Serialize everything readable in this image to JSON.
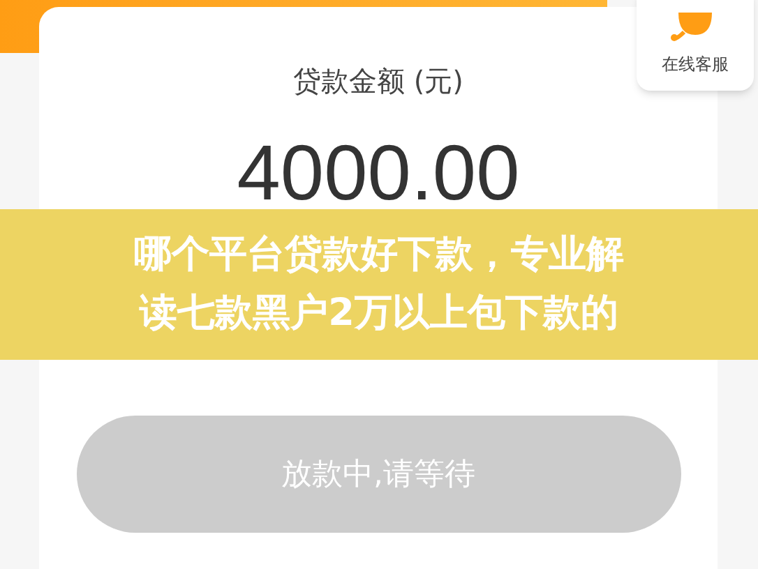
{
  "service": {
    "label": "在线客服"
  },
  "amount_label": "贷款金额 (元)",
  "amount": "4000.00",
  "button": {
    "label": "放款中,请等待",
    "disabled": true
  },
  "caption": {
    "lines": [
      "哪个平台贷款好下款，专业解",
      "读七款黑户2万以上包下款的"
    ]
  }
}
